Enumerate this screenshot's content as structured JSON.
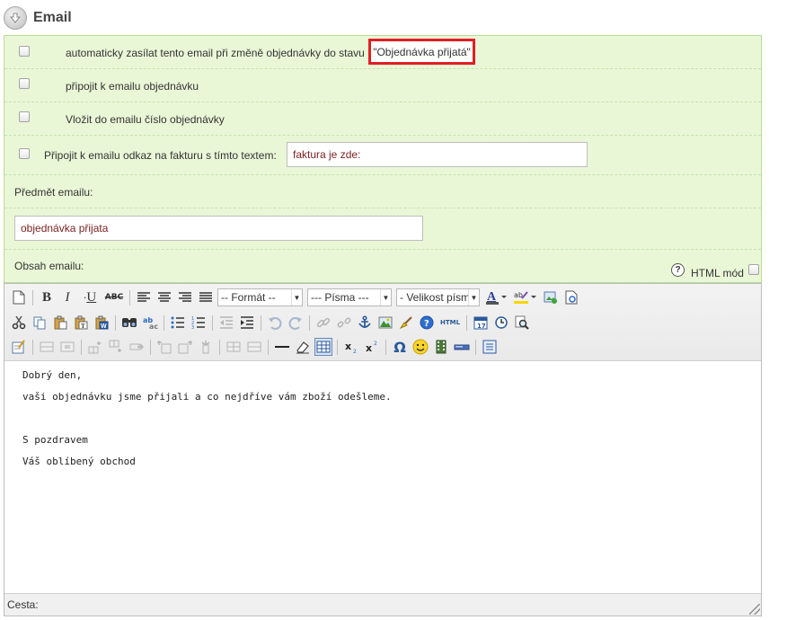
{
  "section": {
    "title": "Email"
  },
  "options": {
    "auto_send": {
      "label": "automaticky zasílat tento email při změně objednávky do stavu",
      "status_value": "\"Objednávka přijatá\"",
      "checked": false
    },
    "attach_order": {
      "label": "připojit k emailu objednávku",
      "checked": false
    },
    "insert_number": {
      "label": "Vložit do emailu číslo objednávky",
      "checked": false
    },
    "invoice_link": {
      "label": "Připojit k emailu odkaz na fakturu s tímto textem:",
      "value": "faktura je zde:",
      "checked": false
    }
  },
  "subject": {
    "label": "Předmět emailu:",
    "value": "objednávka přijata"
  },
  "body_section": {
    "label": "Obsah emailu:",
    "html_mode_label": "HTML mód",
    "help_icon": "question-icon",
    "html_mode_checked": false
  },
  "toolbar": {
    "format_select": "-- Formát --",
    "font_select": "--- Písma ---",
    "size_select": "- Velikost písm",
    "bold": "B",
    "italic": "I",
    "underline": "U",
    "strike": "ABC",
    "html_badge": "HTML",
    "omega": "Ω"
  },
  "content": {
    "lines": [
      "Dobrý den,",
      "vaši objednávku jsme přijali a co nejdříve vám zboží odešleme.",
      "",
      "S pozdravem",
      "Váš oblíbený obchod"
    ]
  },
  "statusbar": {
    "path_label": "Cesta:"
  },
  "colors": {
    "panel_bg": "#eaf7d7",
    "panel_border": "#b9dc97",
    "highlight": "#e11e24"
  }
}
